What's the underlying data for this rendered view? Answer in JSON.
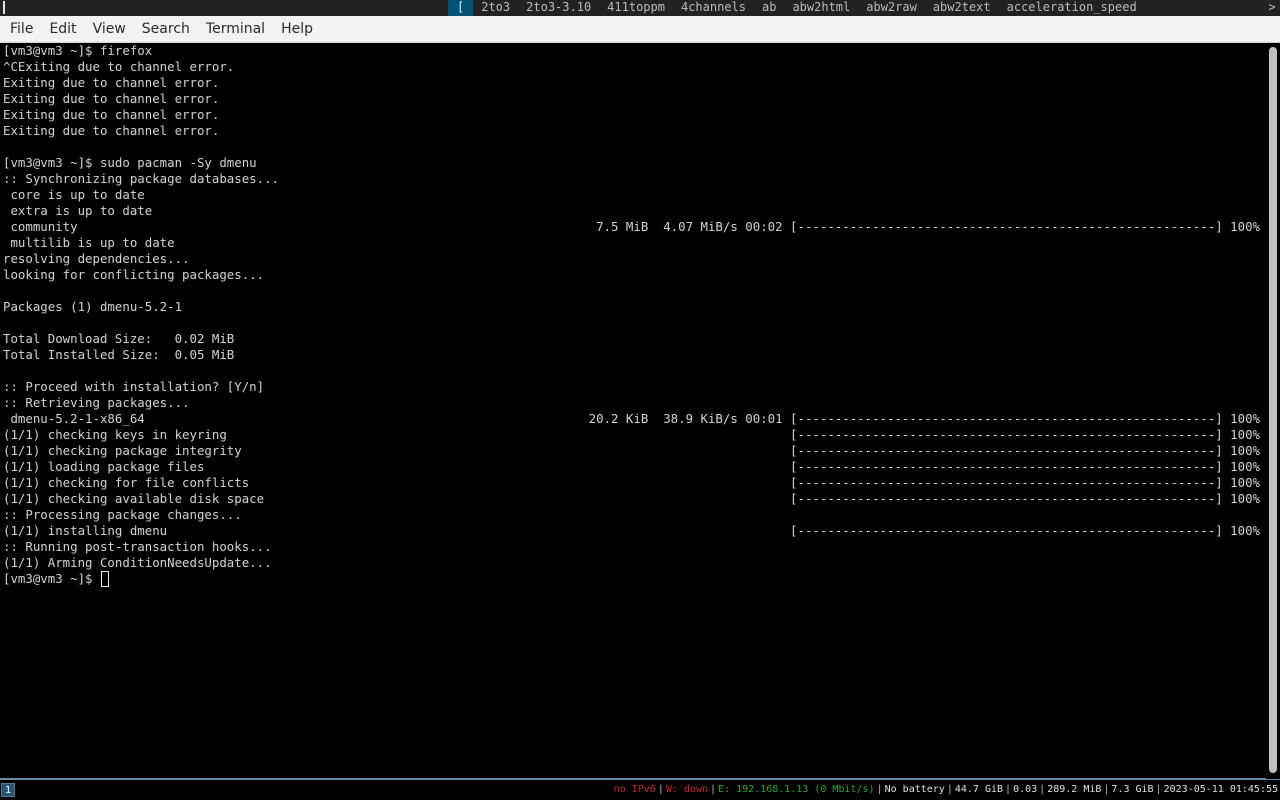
{
  "topbar": {
    "items": [
      {
        "label": "[",
        "selected": true
      },
      {
        "label": "2to3",
        "selected": false
      },
      {
        "label": "2to3-3.10",
        "selected": false
      },
      {
        "label": "411toppm",
        "selected": false
      },
      {
        "label": "4channels",
        "selected": false
      },
      {
        "label": "ab",
        "selected": false
      },
      {
        "label": "abw2html",
        "selected": false
      },
      {
        "label": "abw2raw",
        "selected": false
      },
      {
        "label": "abw2text",
        "selected": false
      },
      {
        "label": "acceleration_speed",
        "selected": false
      }
    ],
    "more_indicator": ">"
  },
  "menubar": {
    "items": [
      "File",
      "Edit",
      "View",
      "Search",
      "Terminal",
      "Help"
    ]
  },
  "terminal": {
    "lines": [
      {
        "left": "[vm3@vm3 ~]$ firefox"
      },
      {
        "left": "^CExiting due to channel error."
      },
      {
        "left": "Exiting due to channel error."
      },
      {
        "left": "Exiting due to channel error."
      },
      {
        "left": "Exiting due to channel error."
      },
      {
        "left": "Exiting due to channel error."
      },
      {
        "left": ""
      },
      {
        "left": "[vm3@vm3 ~]$ sudo pacman -Sy dmenu"
      },
      {
        "left": ":: Synchronizing package databases..."
      },
      {
        "left": " core is up to date"
      },
      {
        "left": " extra is up to date"
      },
      {
        "left": " community",
        "right": "7.5 MiB  4.07 MiB/s 00:02 [--------------------------------------------------------] 100%"
      },
      {
        "left": " multilib is up to date"
      },
      {
        "left": "resolving dependencies..."
      },
      {
        "left": "looking for conflicting packages..."
      },
      {
        "left": ""
      },
      {
        "left": "Packages (1) dmenu-5.2-1"
      },
      {
        "left": ""
      },
      {
        "left": "Total Download Size:   0.02 MiB"
      },
      {
        "left": "Total Installed Size:  0.05 MiB"
      },
      {
        "left": ""
      },
      {
        "left": ":: Proceed with installation? [Y/n]"
      },
      {
        "left": ":: Retrieving packages..."
      },
      {
        "left": " dmenu-5.2-1-x86_64",
        "right": "20.2 KiB  38.9 KiB/s 00:01 [--------------------------------------------------------] 100%"
      },
      {
        "left": "(1/1) checking keys in keyring",
        "right": "[--------------------------------------------------------] 100%"
      },
      {
        "left": "(1/1) checking package integrity",
        "right": "[--------------------------------------------------------] 100%"
      },
      {
        "left": "(1/1) loading package files",
        "right": "[--------------------------------------------------------] 100%"
      },
      {
        "left": "(1/1) checking for file conflicts",
        "right": "[--------------------------------------------------------] 100%"
      },
      {
        "left": "(1/1) checking available disk space",
        "right": "[--------------------------------------------------------] 100%"
      },
      {
        "left": ":: Processing package changes..."
      },
      {
        "left": "(1/1) installing dmenu",
        "right": "[--------------------------------------------------------] 100%"
      },
      {
        "left": ":: Running post-transaction hooks..."
      },
      {
        "left": "(1/1) Arming ConditionNeedsUpdate..."
      },
      {
        "left": "[vm3@vm3 ~]$ ",
        "cursor": true
      }
    ]
  },
  "statusbar": {
    "workspace": "1",
    "items": [
      {
        "text": "no IPv6",
        "color": "#cc2222"
      },
      {
        "text": "W: down",
        "color": "#cc2222"
      },
      {
        "text": "E: 192.168.1.13 (0 Mbit/s)",
        "color": "#22aa22"
      },
      {
        "text": "No battery",
        "color": "#e0e0e0"
      },
      {
        "text": "44.7 GiB",
        "color": "#e0e0e0"
      },
      {
        "text": "0.03",
        "color": "#e0e0e0"
      },
      {
        "text": "289.2 MiB",
        "color": "#e0e0e0"
      },
      {
        "text": "7.3 GiB",
        "color": "#e0e0e0"
      },
      {
        "text": "2023-05-11 01:45:55",
        "color": "#e0e0e0"
      }
    ]
  }
}
